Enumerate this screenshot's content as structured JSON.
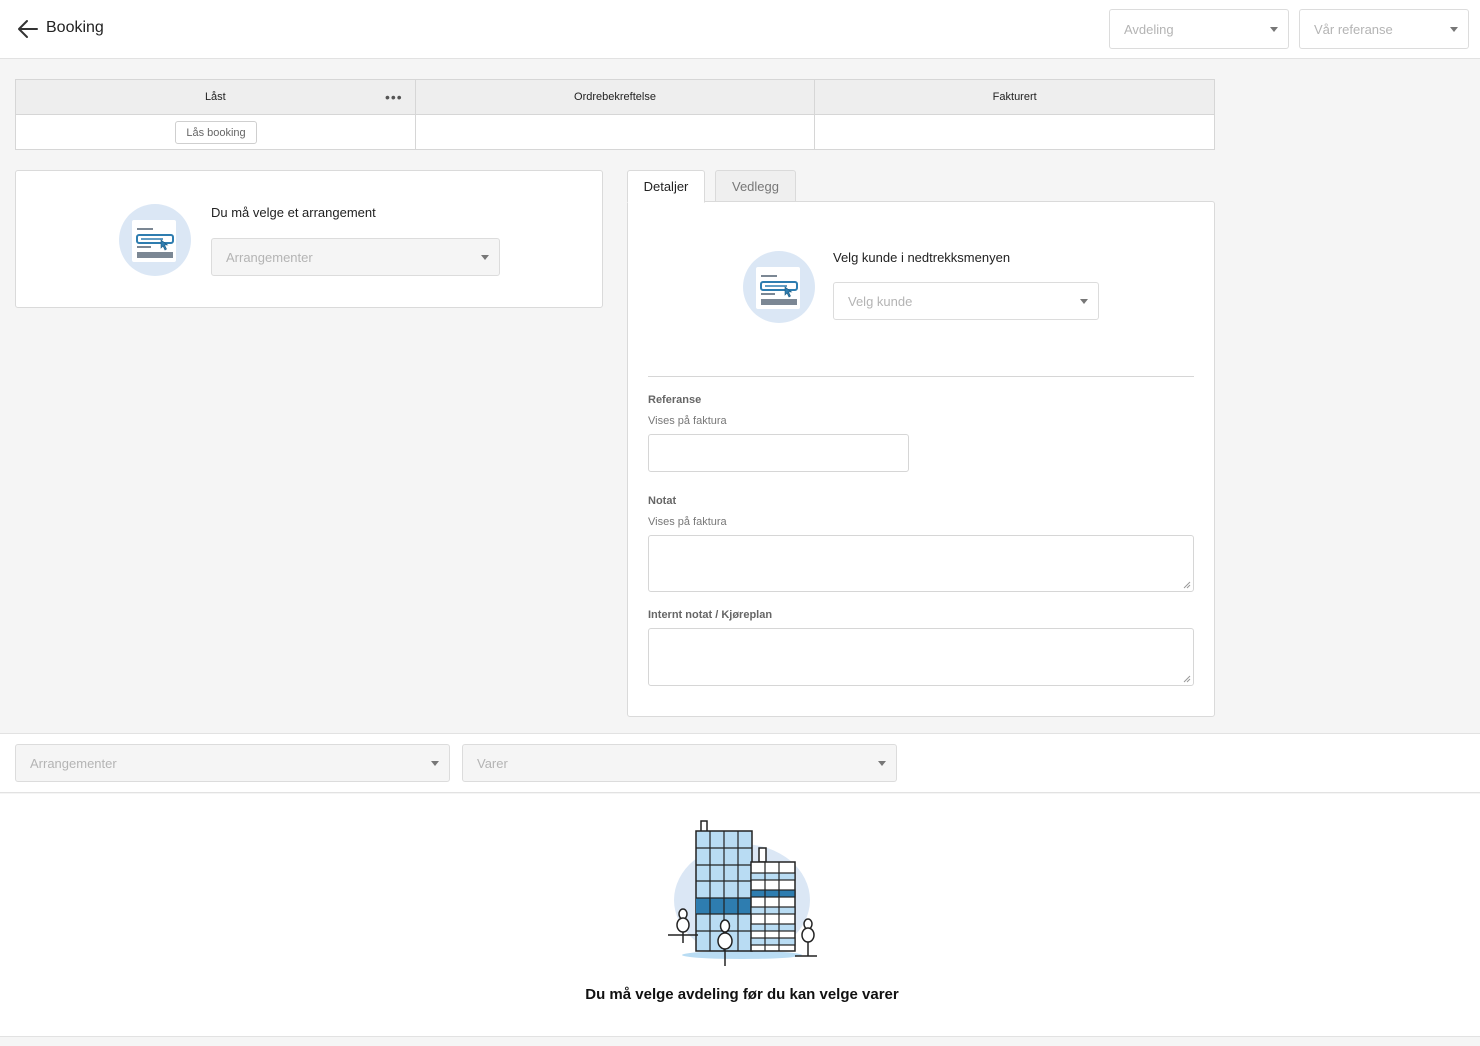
{
  "header": {
    "title": "Booking",
    "department_placeholder": "Avdeling",
    "our_reference_placeholder": "Vår referanse"
  },
  "status_table": {
    "columns": [
      {
        "label": "Låst"
      },
      {
        "label": "Ordrebekreftelse"
      },
      {
        "label": "Fakturert"
      }
    ],
    "lock_button": "Lås booking"
  },
  "event_card": {
    "message": "Du må velge et arrangement",
    "select_placeholder": "Arrangementer"
  },
  "tabs": [
    {
      "label": "Detaljer",
      "active": true
    },
    {
      "label": "Vedlegg",
      "active": false
    }
  ],
  "details": {
    "customer_message": "Velg kunde i nedtrekksmenyen",
    "customer_placeholder": "Velg kunde",
    "reference": {
      "label": "Referanse",
      "sub": "Vises på faktura",
      "value": ""
    },
    "note": {
      "label": "Notat",
      "sub": "Vises på faktura",
      "value": ""
    },
    "internal_note": {
      "label": "Internt notat / Kjøreplan",
      "value": ""
    }
  },
  "toolbar": {
    "events_placeholder": "Arrangementer",
    "items_placeholder": "Varer"
  },
  "empty_state": {
    "message": "Du må velge avdeling før du kan velge varer"
  },
  "colors": {
    "accent_blue": "#2e7db0",
    "light_blue": "#b9dcf3",
    "illustration_bg": "#dbe7f5"
  },
  "icons": [
    "arrow-left-icon",
    "more-horizontal-icon",
    "chevron-down-icon",
    "select-list-illustration",
    "building-illustration"
  ]
}
